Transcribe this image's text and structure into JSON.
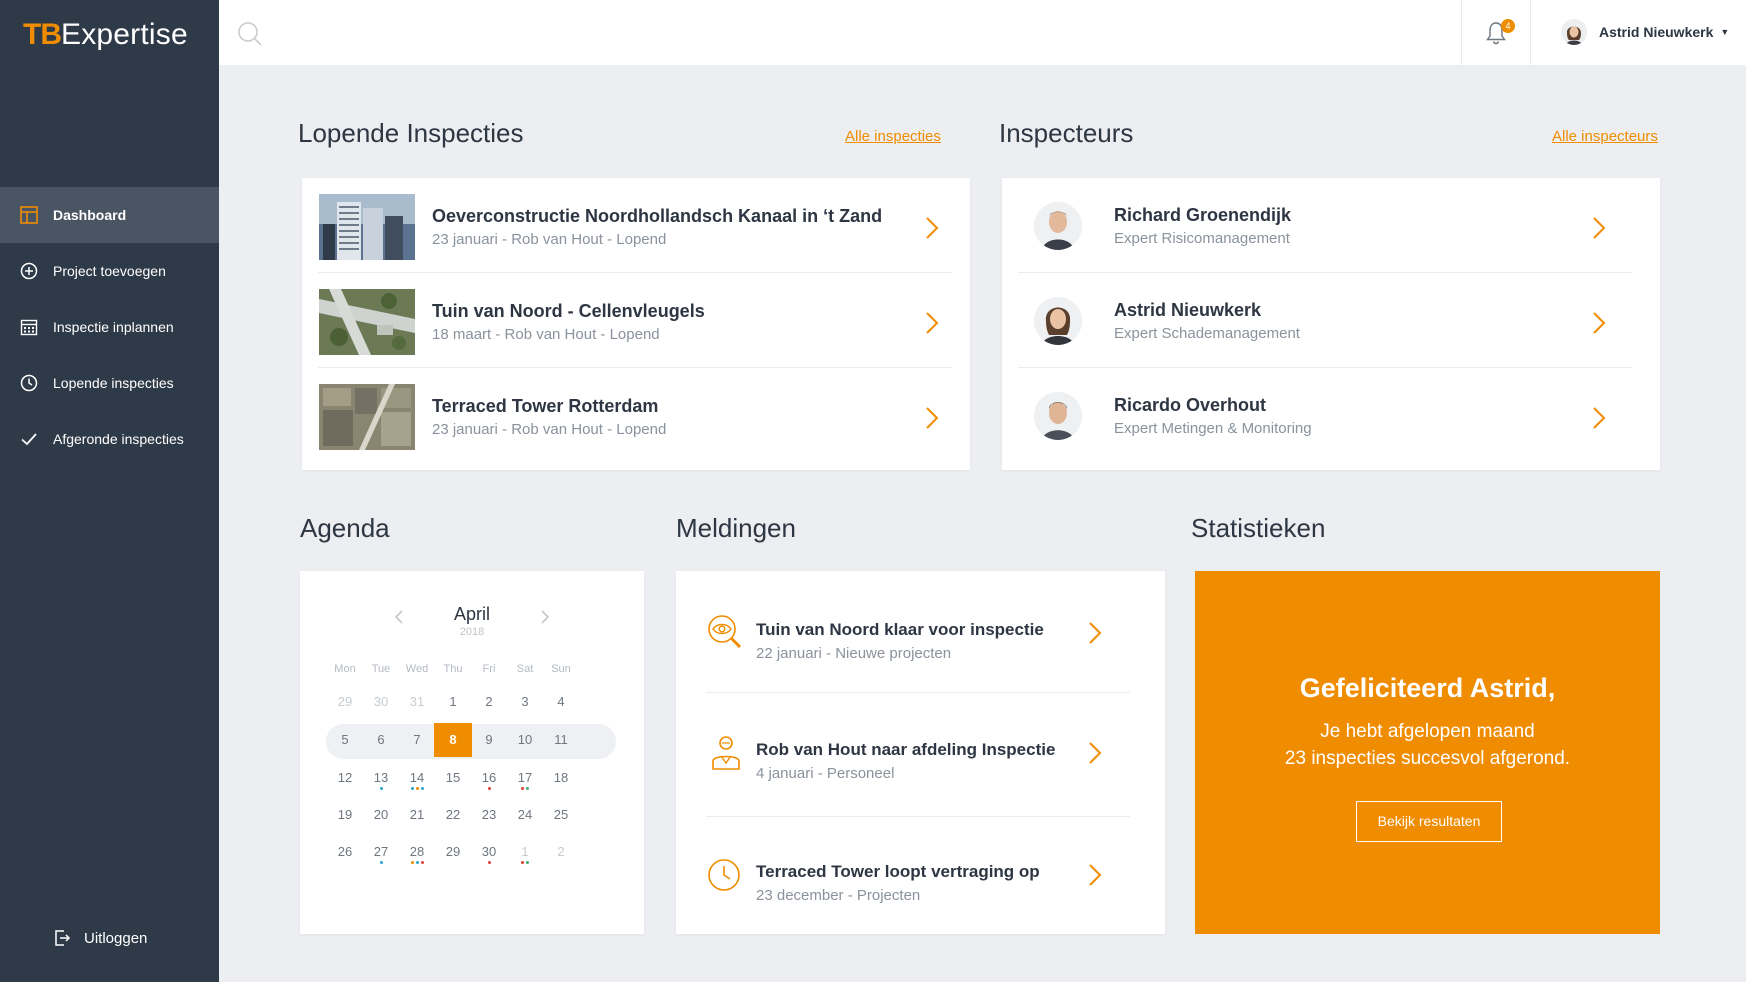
{
  "brand": {
    "prefix": "TB",
    "name": "Expertise",
    "accent": "#f08c00",
    "sidebar_bg": "#2e3a48"
  },
  "nav": {
    "items": [
      {
        "label": "Dashboard",
        "icon": "dashboard-icon",
        "active": true
      },
      {
        "label": "Project toevoegen",
        "icon": "plus-circle-icon"
      },
      {
        "label": "Inspectie inplannen",
        "icon": "calendar-icon"
      },
      {
        "label": "Lopende inspecties",
        "icon": "clock-icon"
      },
      {
        "label": "Afgeronde inspecties",
        "icon": "check-icon"
      }
    ],
    "logout": "Uitloggen"
  },
  "topbar": {
    "notification_count": "4",
    "user_name": "Astrid Nieuwkerk"
  },
  "inspecties": {
    "title": "Lopende Inspecties",
    "all_link": "Alle inspecties",
    "items": [
      {
        "title": "Oeverconstructie Noordhollandsch Kanaal in ‘t Zand",
        "meta": "23 januari  -  Rob van Hout  -  Lopend"
      },
      {
        "title": "Tuin van Noord - Cellenvleugels",
        "meta": "18 maart  -  Rob van Hout  -  Lopend"
      },
      {
        "title": "Terraced Tower Rotterdam",
        "meta": "23 januari  -  Rob van Hout  -  Lopend"
      }
    ]
  },
  "inspecteurs": {
    "title": "Inspecteurs",
    "all_link": "Alle inspecteurs",
    "items": [
      {
        "name": "Richard Groenendijk",
        "role": "Expert Risicomanagement"
      },
      {
        "name": "Astrid Nieuwkerk",
        "role": "Expert Schademanagement"
      },
      {
        "name": "Ricardo Overhout",
        "role": "Expert Metingen & Monitoring"
      }
    ]
  },
  "agenda": {
    "title": "Agenda",
    "month": "April",
    "year": "2018",
    "weekdays": [
      "Mon",
      "Tue",
      "Wed",
      "Thu",
      "Fri",
      "Sat",
      "Sun"
    ],
    "weeks": [
      [
        "29",
        "30",
        "31",
        "1",
        "2",
        "3",
        "4"
      ],
      [
        "5",
        "6",
        "7",
        "8",
        "9",
        "10",
        "11"
      ],
      [
        "12",
        "13",
        "14",
        "15",
        "16",
        "17",
        "18"
      ],
      [
        "19",
        "20",
        "21",
        "22",
        "23",
        "24",
        "25"
      ],
      [
        "26",
        "27",
        "28",
        "29",
        "30",
        "1",
        "2"
      ]
    ],
    "selected_day": "8"
  },
  "meldingen": {
    "title": "Meldingen",
    "items": [
      {
        "title": "Tuin van Noord klaar voor inspectie",
        "meta": "22 januari - Nieuwe projecten",
        "icon": "eye-search-icon"
      },
      {
        "title": "Rob van Hout naar afdeling Inspectie",
        "meta": "4 januari - Personeel",
        "icon": "person-icon"
      },
      {
        "title": "Terraced Tower loopt vertraging op",
        "meta": "23 december - Projecten",
        "icon": "clock-icon"
      }
    ]
  },
  "statistieken": {
    "title": "Statistieken",
    "heading": "Gefeliciteerd Astrid,",
    "line1": "Je hebt afgelopen maand",
    "line2": "23 inspecties succesvol afgerond.",
    "button": "Bekijk resultaten"
  }
}
